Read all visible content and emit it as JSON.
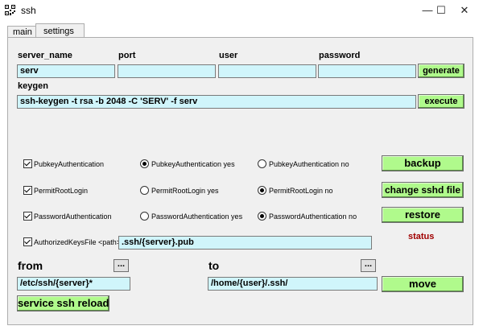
{
  "window": {
    "title": "ssh",
    "minimize_glyph": "—",
    "maximize_glyph": "☐",
    "close_glyph": "✕"
  },
  "tabs": [
    {
      "label": "main"
    },
    {
      "label": "settings"
    }
  ],
  "connection": {
    "server_name_label": "server_name",
    "server_name_value": "serv",
    "port_label": "port",
    "port_value": "",
    "user_label": "user",
    "user_value": "",
    "password_label": "password",
    "password_value": "",
    "generate_label": "generate"
  },
  "keygen": {
    "label": "keygen",
    "command": "ssh-keygen -t rsa -b 2048 -C 'SERV' -f serv",
    "execute_label": "execute"
  },
  "options": [
    {
      "checkbox": "PubkeyAuthentication",
      "yes": "PubkeyAuthentication yes",
      "no": "PubkeyAuthentication no",
      "selected": "yes"
    },
    {
      "checkbox": "PermitRootLogin",
      "yes": "PermitRootLogin yes",
      "no": "PermitRootLogin no",
      "selected": "no"
    },
    {
      "checkbox": "PasswordAuthentication",
      "yes": "PasswordAuthentication yes",
      "no": "PasswordAuthentication no",
      "selected": "no"
    }
  ],
  "authorized_keys": {
    "label": "AuthorizedKeysFile <path>",
    "value": ".ssh/{server}.pub"
  },
  "actions": {
    "backup": "backup",
    "change_sshd": "change sshd file",
    "restore": "restore",
    "status": "status"
  },
  "transfer": {
    "from_label": "from",
    "from_value": "/etc/ssh/{server}*",
    "from_browse": "...",
    "to_label": "to",
    "to_value": "/home/{user}/.ssh/",
    "to_browse": "...",
    "move_label": "move"
  },
  "reload_label": "service ssh reload",
  "colors": {
    "field_bg": "#d0f5fb",
    "button_bg": "#b0fa8c",
    "status_text": "#a00000"
  }
}
